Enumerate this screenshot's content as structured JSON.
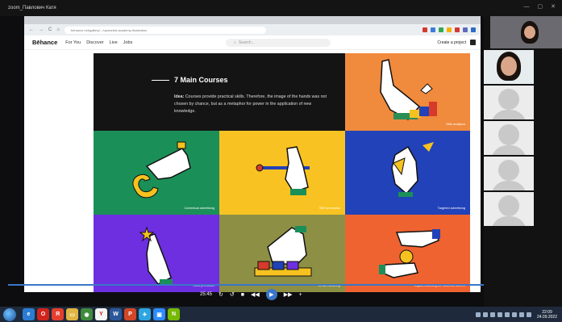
{
  "meeting": {
    "title": "zoom_Павлович Катя"
  },
  "browser": {
    "url": "behance.net/gallery/.../upmarket-academy-illustration"
  },
  "behance_nav": {
    "logo": "Bēhance",
    "links": [
      "For You",
      "Discover",
      "Live",
      "Jobs"
    ],
    "search_placeholder": "Search...",
    "create_label": "Create a project"
  },
  "gallery": {
    "title": "7 Main Courses",
    "description_lead": "Idea:",
    "description": " Courses provide practical skills. Therefore, the image of the hands was not chosen by chance, but as a metaphor for power in the application of new knowledge.",
    "captions": {
      "top_right": "Web analytics",
      "row2_left": "Contextual advertising",
      "row2_mid": "SEO promotion",
      "row2_right": "Targeted advertising",
      "row3_left": "SMM promotion",
      "row3_mid": "Email marketing",
      "row3_right": "Digital marketing for business owners"
    },
    "colors": {
      "intro": "#141414",
      "analytics": "#f08a3c",
      "context": "#1b8f58",
      "seo": "#f8c322",
      "targeted": "#2142b8",
      "smm": "#6d2fe0",
      "email": "#8d8f44",
      "digital": "#ef6331"
    }
  },
  "player": {
    "time": "25:45",
    "ctrl_left": "↻",
    "ctrl_mid": "↺",
    "ctrl_stop": "■",
    "ctrl_rewind": "◀◀",
    "ctrl_play": "▶",
    "ctrl_forward": "▶▶",
    "ctrl_volume": "+"
  },
  "taskbar": {
    "apps": [
      {
        "icon": "ie-icon",
        "label": "e",
        "color": "#2b7cd3"
      },
      {
        "icon": "opera-icon",
        "label": "O",
        "color": "#d0241c"
      },
      {
        "icon": "yandex-icon",
        "label": "Я",
        "color": "#e53f2e"
      },
      {
        "icon": "folder-icon",
        "label": "▭",
        "color": "#e1b540"
      },
      {
        "icon": "chrome-icon",
        "label": "◉",
        "color": "#3f8a3c"
      },
      {
        "icon": "yandex-browser-icon",
        "label": "Y",
        "color": "#f5f5f5"
      },
      {
        "icon": "word-icon",
        "label": "W",
        "color": "#2b579a"
      },
      {
        "icon": "powerpoint-icon",
        "label": "P",
        "color": "#d24726"
      },
      {
        "icon": "telegram-icon",
        "label": "✈",
        "color": "#2ca5e0"
      },
      {
        "icon": "zoom-icon",
        "label": "▣",
        "color": "#2d8cff"
      },
      {
        "icon": "nvidia-icon",
        "label": "N",
        "color": "#76b900"
      }
    ],
    "time": "22:09",
    "date": "24.09.2022"
  }
}
